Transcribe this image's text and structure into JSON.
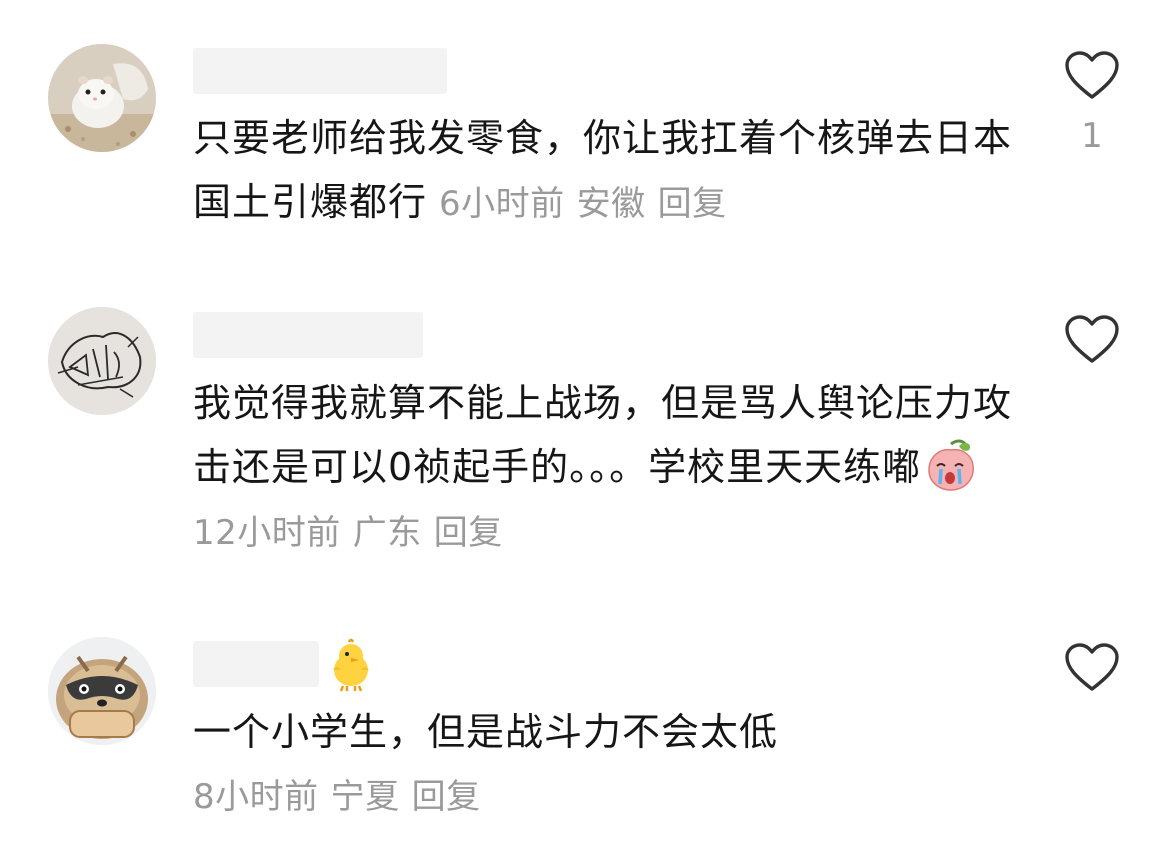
{
  "comments": [
    {
      "username": "",
      "text": "只要老师给我发零食，你让我扛着个核弹去日本国土引爆都行",
      "time": "6小时前",
      "location": "安徽",
      "reply_label": "回复",
      "like_count": "1",
      "avatar_icon": "hamster-avatar-icon",
      "like_icon": "heart-outline-icon"
    },
    {
      "username": "",
      "text": "我觉得我就算不能上战场，但是骂人舆论压力攻击还是可以0祯起手的。。。学校里天天练嘟",
      "inline_emoji": "crying-peach-emoji",
      "time": "12小时前",
      "location": "广东",
      "reply_label": "回复",
      "like_count": "",
      "avatar_icon": "sketch-avatar-icon",
      "like_icon": "heart-outline-icon"
    },
    {
      "username": "",
      "name_badge": "chick-emoji",
      "text": "一个小学生，但是战斗力不会太低",
      "time": "8小时前",
      "location": "宁夏",
      "reply_label": "回复",
      "like_count": "",
      "avatar_icon": "raccoon-avatar-icon",
      "like_icon": "heart-outline-icon"
    }
  ],
  "colors": {
    "text": "#161616",
    "meta": "#9a9a9a",
    "heart_stroke": "#333333",
    "name_redaction": "#f3f3f3"
  }
}
